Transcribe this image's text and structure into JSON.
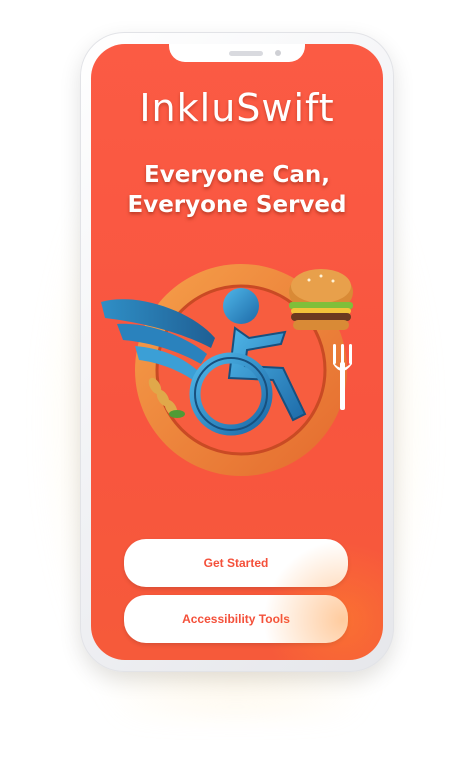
{
  "app": {
    "brand": "InkluSwift",
    "tagline_line1": "Everyone Can,",
    "tagline_line2": "Everyone Served"
  },
  "logo": {
    "icons": [
      "wheelchair-user-icon",
      "wing-icon",
      "burger-icon",
      "fork-icon",
      "wheat-icon"
    ]
  },
  "actions": {
    "get_started_label": "Get Started",
    "accessibility_tools_label": "Accessibility Tools"
  },
  "colors": {
    "background": "#f8553f",
    "button_text": "#f4503a",
    "button_bg": "#ffffff",
    "logo_ring": "#f4873d",
    "logo_figure": "#2d8fc9"
  }
}
